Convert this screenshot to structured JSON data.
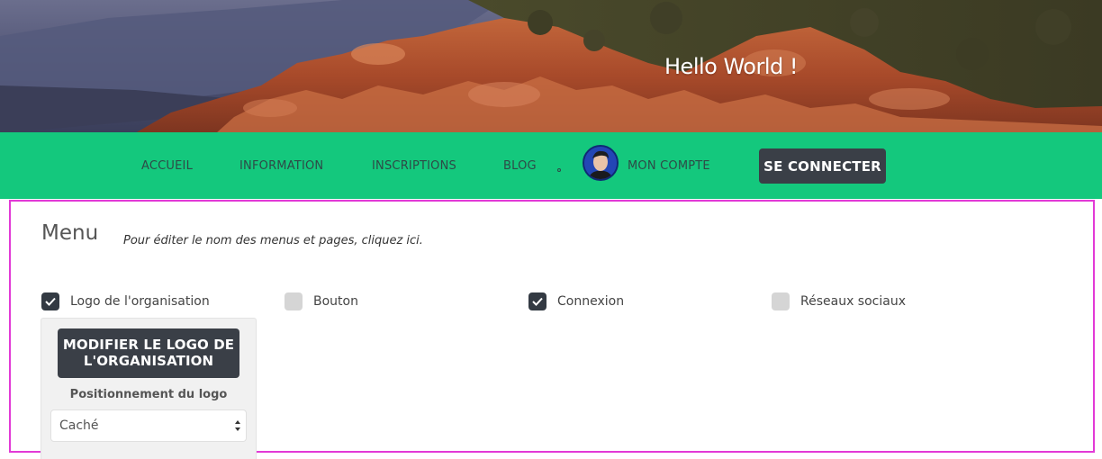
{
  "hero": {
    "title": "Hello World !"
  },
  "nav": {
    "items": [
      {
        "label": "ACCUEIL"
      },
      {
        "label": "INFORMATION"
      },
      {
        "label": "INSCRIPTIONS"
      },
      {
        "label": "BLOG"
      }
    ],
    "account_label": "MON COMPTE",
    "login_label": "SE CONNECTER"
  },
  "menu": {
    "title": "Menu",
    "hint": "Pour éditer le nom des menus et pages, cliquez ici.",
    "options": [
      {
        "label": "Logo de l'organisation",
        "checked": true
      },
      {
        "label": "Bouton",
        "checked": false
      },
      {
        "label": "Connexion",
        "checked": true
      },
      {
        "label": "Réseaux sociaux",
        "checked": false
      }
    ],
    "logo_panel": {
      "button_line1": "MODIFIER LE LOGO DE",
      "button_line2": "L'ORGANISATION",
      "position_label": "Positionnement du logo",
      "position_value": "Caché"
    }
  },
  "colors": {
    "nav_bg": "#14c87d",
    "dark_button": "#3a3f47",
    "highlight_border": "#e23ad6"
  }
}
